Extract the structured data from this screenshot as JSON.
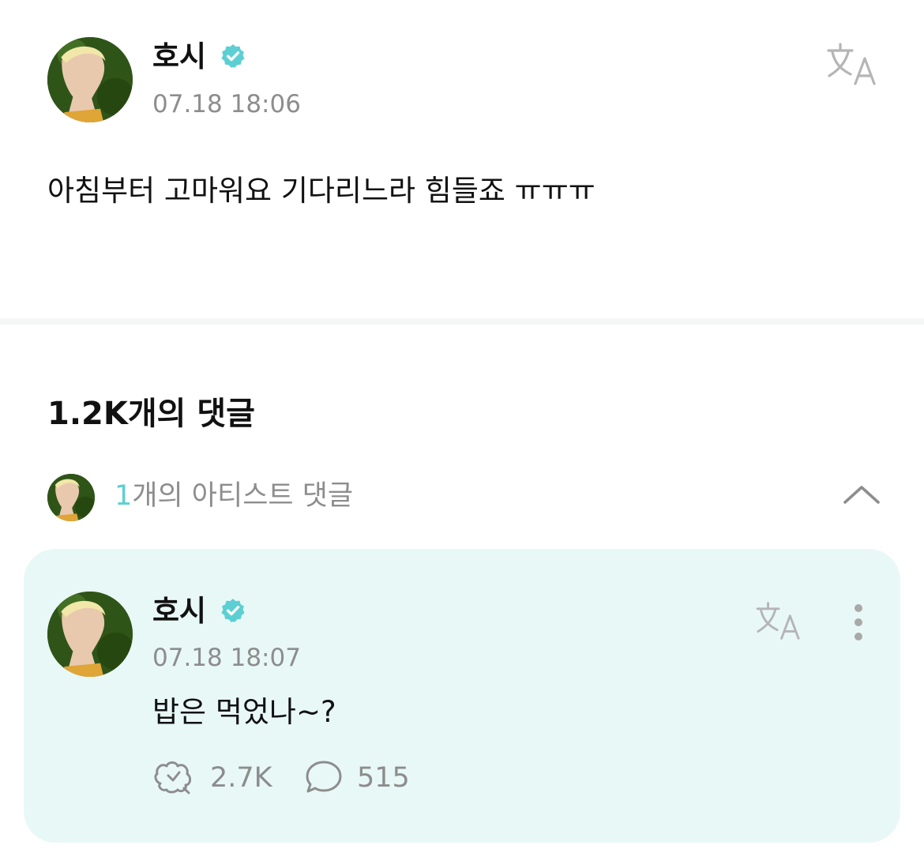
{
  "post": {
    "author": "호시",
    "timestamp": "07.18 18:06",
    "body": "아침부터 고마워요 기다리느라 힘들죠 ㅠㅠㅠ"
  },
  "comments": {
    "count_label": "1.2K개의 댓글",
    "artist_comments": {
      "count": "1",
      "label": "개의 아티스트 댓글"
    }
  },
  "artist_comment": {
    "author": "호시",
    "timestamp": "07.18 18:07",
    "body": "밥은 먹었나~?",
    "likes": "2.7K",
    "replies": "515"
  },
  "colors": {
    "accent": "#5ccfd3",
    "card_background": "#e8f8f6",
    "muted_text": "#8d8d8d"
  },
  "icons": {
    "verified": "verified-badge-icon",
    "translate": "translate-icon",
    "chevron": "chevron-up-icon",
    "like": "like-icon",
    "reply": "reply-bubble-icon",
    "more": "more-vertical-icon"
  }
}
